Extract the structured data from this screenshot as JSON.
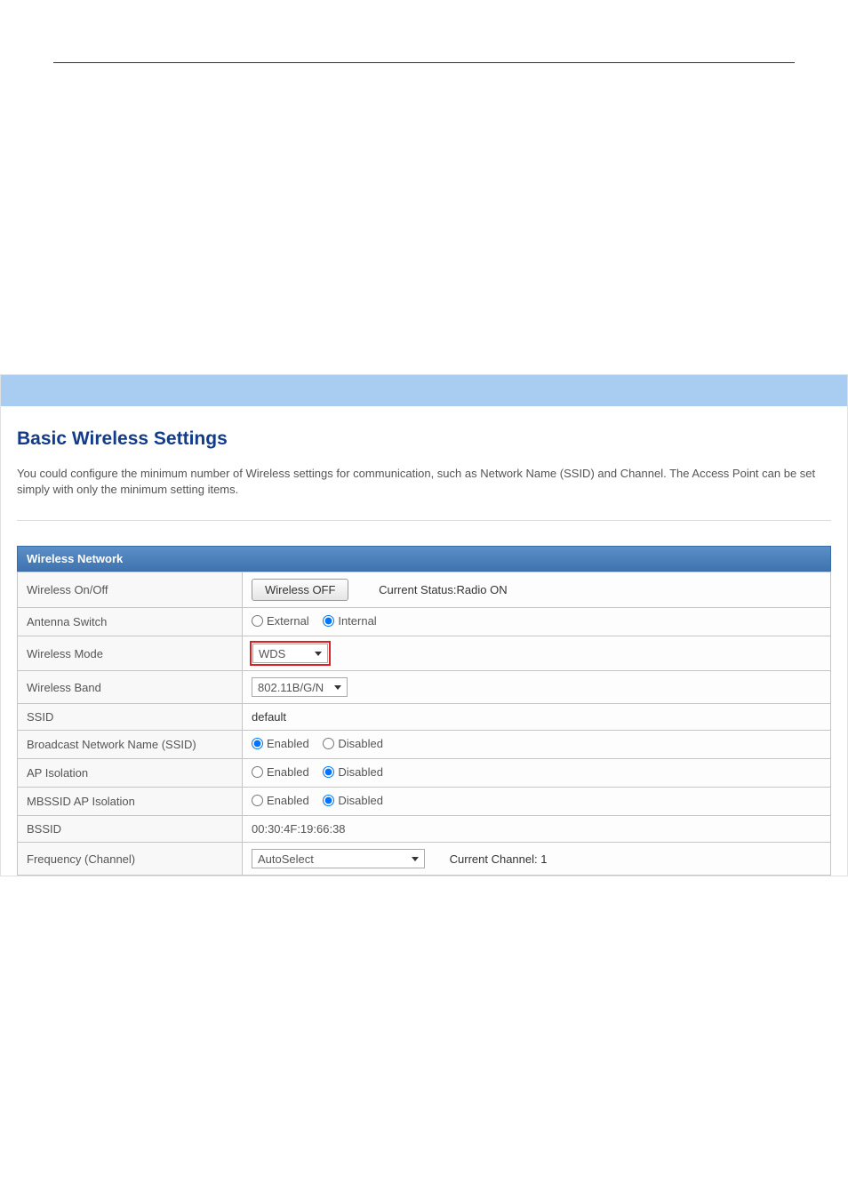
{
  "page": {
    "title": "Basic Wireless Settings",
    "description": "You could configure the minimum number of Wireless settings for communication, such as Network Name (SSID) and Channel. The Access Point can be set simply with only the minimum setting items."
  },
  "section": {
    "header": "Wireless Network"
  },
  "rows": {
    "wireless_onoff": {
      "label": "Wireless On/Off",
      "button": "Wireless OFF",
      "status": "Current Status:Radio ON"
    },
    "antenna_switch": {
      "label": "Antenna Switch",
      "opt1": "External",
      "opt2": "Internal"
    },
    "wireless_mode": {
      "label": "Wireless Mode",
      "value": "WDS"
    },
    "wireless_band": {
      "label": "Wireless Band",
      "value": "802.11B/G/N"
    },
    "ssid": {
      "label": "SSID",
      "value": "default"
    },
    "broadcast": {
      "label": "Broadcast Network Name (SSID)",
      "opt1": "Enabled",
      "opt2": "Disabled"
    },
    "ap_isolation": {
      "label": "AP Isolation",
      "opt1": "Enabled",
      "opt2": "Disabled"
    },
    "mbssid": {
      "label": "MBSSID AP Isolation",
      "opt1": "Enabled",
      "opt2": "Disabled"
    },
    "bssid": {
      "label": "BSSID",
      "value": "00:30:4F:19:66:38"
    },
    "frequency": {
      "label": "Frequency (Channel)",
      "value": "AutoSelect",
      "status": "Current Channel: 1"
    }
  }
}
